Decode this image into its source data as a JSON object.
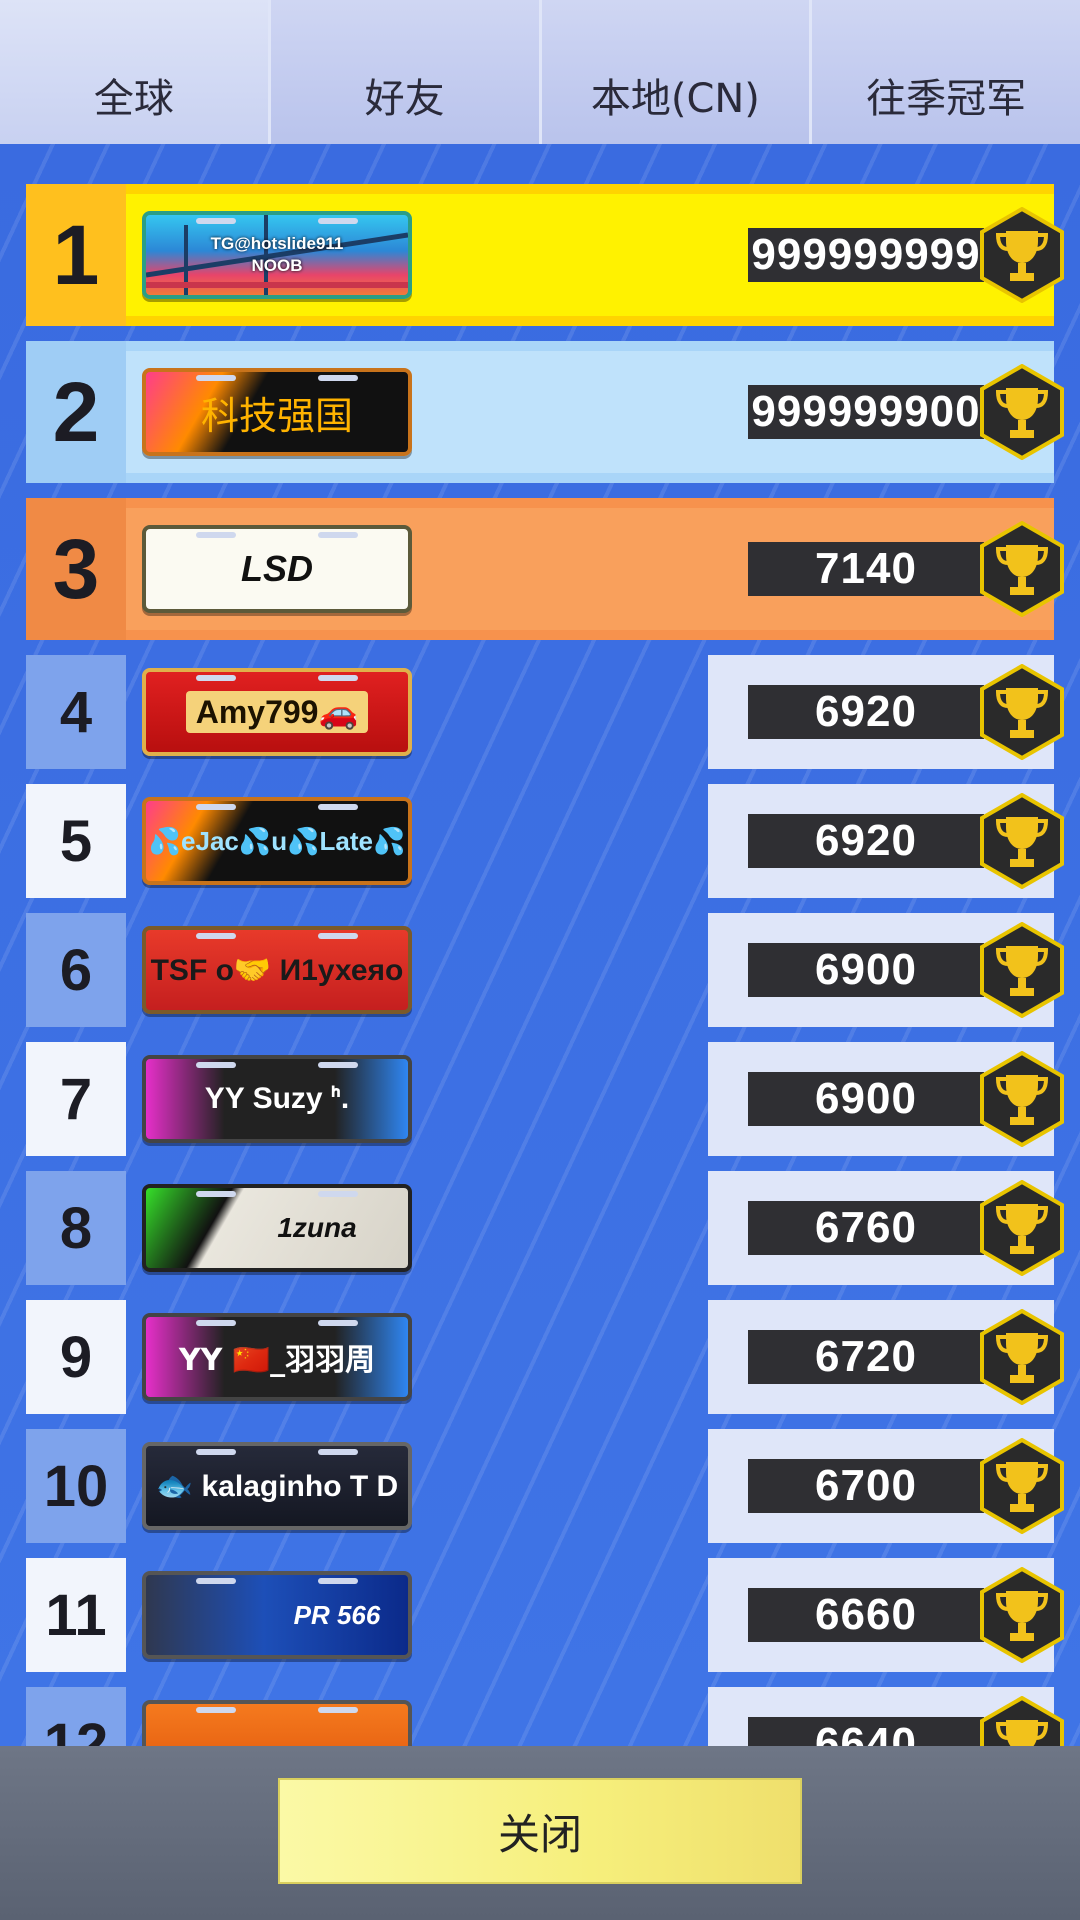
{
  "tabs": [
    {
      "label": "全球",
      "active": true
    },
    {
      "label": "好友",
      "active": false
    },
    {
      "label": "本地(CN)",
      "active": false
    },
    {
      "label": "往季冠军",
      "active": false
    }
  ],
  "leaderboard": [
    {
      "rank": "1",
      "plate": "TG@hotslide911 NOOB",
      "score": "999999999"
    },
    {
      "rank": "2",
      "plate": "科技强国",
      "score": "999999900"
    },
    {
      "rank": "3",
      "plate": "LSD",
      "score": "7140"
    },
    {
      "rank": "4",
      "plate": "Amy799🚗",
      "score": "6920"
    },
    {
      "rank": "5",
      "plate": "💦eJac💦u💦Late💦",
      "score": "6920"
    },
    {
      "rank": "6",
      "plate": "TSF o🤝 И1ухеяо",
      "score": "6900"
    },
    {
      "rank": "7",
      "plate": "YY Suzy ᑋ.",
      "score": "6900"
    },
    {
      "rank": "8",
      "plate": "1zuna",
      "score": "6760"
    },
    {
      "rank": "9",
      "plate": "YY 🇨🇳_羽羽周",
      "score": "6720"
    },
    {
      "rank": "10",
      "plate": "🐟 kalaginho T D",
      "score": "6700"
    },
    {
      "rank": "11",
      "plate": "PR 566",
      "score": "6660"
    },
    {
      "rank": "12",
      "plate": "",
      "score": "6640"
    }
  ],
  "footer": {
    "close_label": "关闭"
  },
  "colors": {
    "gold": "#ffd400",
    "silver": "#b6dcfa",
    "bronze": "#f79a55",
    "board": "#3d6ee0",
    "close_button": "#f6ef7c"
  },
  "icons": {
    "score_badge": "trophy-icon"
  }
}
